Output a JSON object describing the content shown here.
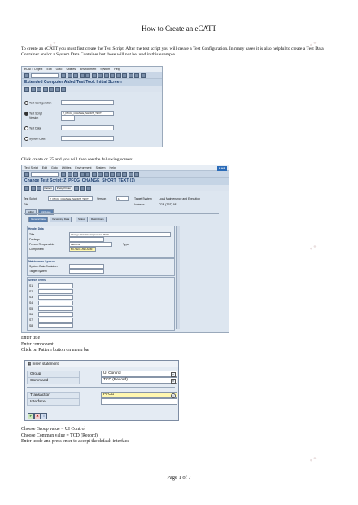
{
  "document": {
    "title": "How to Create an eCATT",
    "intro": "To create an eCATT you must first create the Test Script. After the test script you will create a Test Configuration. In many cases it is also helpful to create a Test Data Container and/or a System Data Container but these will not be used in this example.",
    "para_screen": "Click create or F5 and you will then see the following screen:",
    "steps_1": [
      "Enter title",
      "Enter component",
      "Click on Pattern button on menu bar"
    ],
    "steps_2": [
      "Choose Group value = UI Control",
      "Choose Comman value = TCD (Record)",
      "Enter tcode and press enter to accept the default interface"
    ],
    "footer": "Page 1 of 7"
  },
  "screenshot1": {
    "menu": [
      "eCATT Object",
      "Edit",
      "Goto",
      "Utilities",
      "Environment",
      "System",
      "Help"
    ],
    "app_title": "Extended Computer Aided Test Tool: Initial Screen",
    "options": [
      {
        "label": "Test Configuration",
        "selected": false,
        "value": ""
      },
      {
        "label": "Test Script",
        "selected": true,
        "value": "Z_PFCG_CHANGE_SHORT_TEXT"
      },
      {
        "label": "Version",
        "selected": false,
        "value": ""
      },
      {
        "label": "Test Data",
        "selected": false,
        "value": ""
      },
      {
        "label": "System Data",
        "selected": false,
        "value": ""
      }
    ]
  },
  "screenshot2": {
    "menu": [
      "Test Script",
      "Edit",
      "Goto",
      "Utilities",
      "Environment",
      "System",
      "Help"
    ],
    "app_title": "Change Test Script: Z_PFCG_CHANGE_SHORT_TEXT (1)",
    "pattern_btn": "Pattern",
    "pretty_btn": "Pretty Printer",
    "sap_logo": "SAP",
    "header": {
      "test_script_label": "Test Script",
      "test_script_value": "Z_PFCG_CHANGE_SHORT_TEXT",
      "version_label": "Version",
      "version_value": "1",
      "target_system_label": "Target System",
      "target_system_value": "Local Maintenance and Execution",
      "title_label": "Title",
      "instance_label": "Instance",
      "instance_value": "PRD (TST) 02"
    },
    "main_tabs": [
      "Editor",
      "Attributes"
    ],
    "sub_tabs": [
      "General Data",
      "Versioning Data",
      "Status",
      "Restrictions"
    ],
    "header_data": {
      "heading": "Header Data",
      "fields": [
        {
          "label": "Title",
          "value": "Change Role Description via PFCG"
        },
        {
          "label": "Package",
          "value": ""
        },
        {
          "label": "Person Responsible",
          "value": "BEKOW"
        },
        {
          "label": "Component",
          "value": "BC-SEC-USR-ADM"
        }
      ],
      "type_label": "Type"
    },
    "maintenance": {
      "heading": "Maintenance System",
      "fields": [
        "System Data Container",
        "Target System"
      ]
    },
    "search": {
      "heading": "Search Terms",
      "rows": [
        "S1",
        "S2",
        "S3",
        "S4",
        "S5",
        "S6",
        "S7",
        "S8"
      ]
    }
  },
  "dialog": {
    "title": "Insert statement",
    "rows": [
      {
        "label": "Group",
        "value": "UI Control",
        "dropdown": true,
        "highlight": false
      },
      {
        "label": "Command",
        "value": "TCD (Record)",
        "dropdown": true,
        "highlight": false
      },
      {
        "label": "Transaction",
        "value": "PFCG",
        "dropdown": false,
        "highlight": true
      },
      {
        "label": "Interface",
        "value": "",
        "dropdown": false,
        "highlight": false
      }
    ]
  }
}
